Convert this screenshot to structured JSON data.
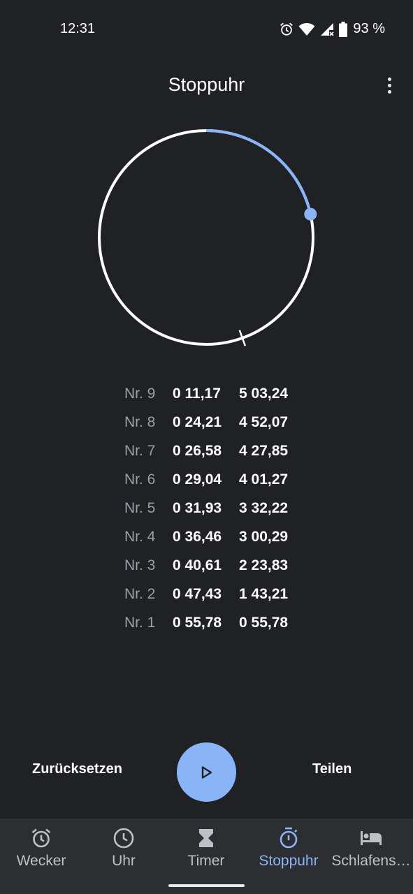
{
  "status_bar": {
    "time": "12:31",
    "battery_text": "93 %",
    "icons": [
      "alarm-icon",
      "wifi-icon",
      "cell-signal-off-icon",
      "battery-icon"
    ]
  },
  "app_bar": {
    "title": "Stoppuhr",
    "menu_icon": "more-vert-icon"
  },
  "stopwatch": {
    "progress_fraction": 0.215,
    "lap_marker_fraction": 0.445,
    "laps": [
      {
        "num": "Nr. 9",
        "lap": "0 11,17",
        "total": "5 03,24"
      },
      {
        "num": "Nr. 8",
        "lap": "0 24,21",
        "total": "4 52,07"
      },
      {
        "num": "Nr. 7",
        "lap": "0 26,58",
        "total": "4 27,85"
      },
      {
        "num": "Nr. 6",
        "lap": "0 29,04",
        "total": "4 01,27"
      },
      {
        "num": "Nr. 5",
        "lap": "0 31,93",
        "total": "3 32,22"
      },
      {
        "num": "Nr. 4",
        "lap": "0 36,46",
        "total": "3 00,29"
      },
      {
        "num": "Nr. 3",
        "lap": "0 40,61",
        "total": "2 23,83"
      },
      {
        "num": "Nr. 2",
        "lap": "0 47,43",
        "total": "1 43,21"
      },
      {
        "num": "Nr. 1",
        "lap": "0 55,78",
        "total": "0 55,78"
      }
    ]
  },
  "controls": {
    "reset_label": "Zurücksetzen",
    "share_label": "Teilen",
    "play_icon": "play-icon"
  },
  "bottom_nav": {
    "items": [
      {
        "label": "Wecker",
        "icon": "alarm-icon",
        "active": false
      },
      {
        "label": "Uhr",
        "icon": "clock-icon",
        "active": false
      },
      {
        "label": "Timer",
        "icon": "hourglass-icon",
        "active": false
      },
      {
        "label": "Stoppuhr",
        "icon": "stopwatch-icon",
        "active": true
      },
      {
        "label": "Schlafens…",
        "icon": "bed-icon",
        "active": false
      }
    ]
  },
  "colors": {
    "background": "#202124",
    "accent": "#8ab4f8",
    "nav_background": "#2d2e31",
    "muted_text": "#9aa0a6"
  }
}
